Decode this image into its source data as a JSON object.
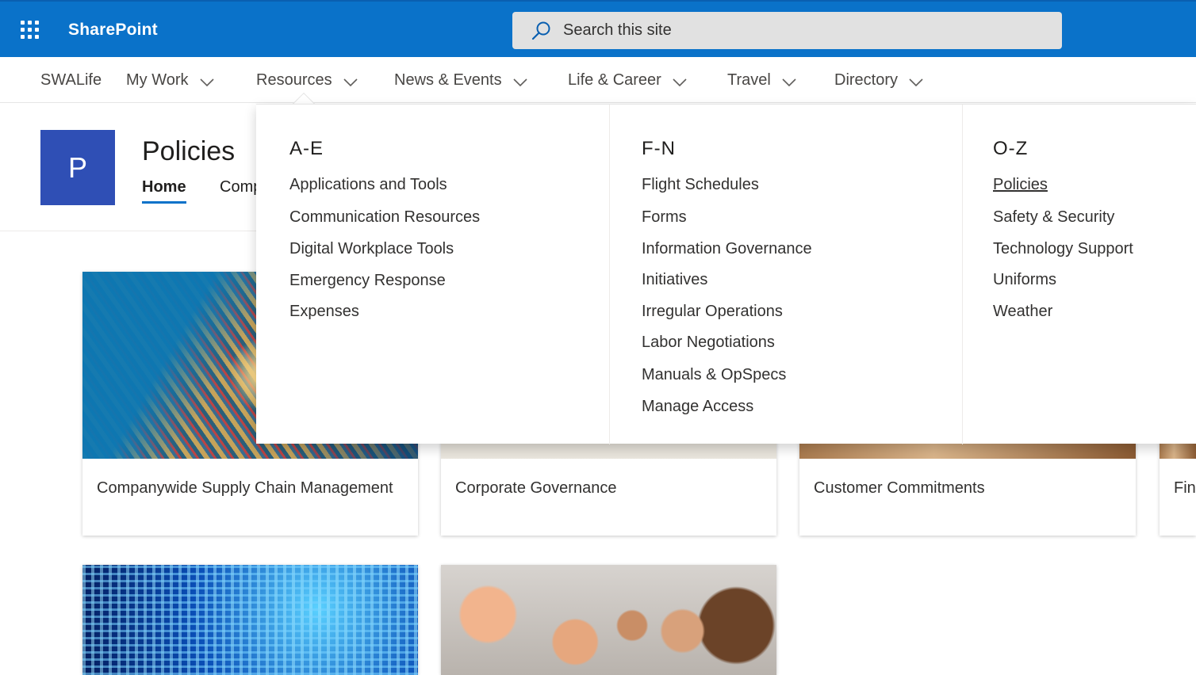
{
  "suite": {
    "brand": "SharePoint",
    "search_placeholder": "Search this site",
    "accent": "#0a72c9"
  },
  "hub_nav": {
    "items": [
      {
        "label": "SWALife",
        "has_dropdown": false
      },
      {
        "label": "My Work",
        "has_dropdown": true
      },
      {
        "label": "Resources",
        "has_dropdown": true
      },
      {
        "label": "News & Events",
        "has_dropdown": true
      },
      {
        "label": "Life & Career",
        "has_dropdown": true
      },
      {
        "label": "Travel",
        "has_dropdown": true
      },
      {
        "label": "Directory",
        "has_dropdown": true
      }
    ]
  },
  "site": {
    "logo_letter": "P",
    "logo_color": "#2f4fb5",
    "title": "Policies",
    "tabs": [
      {
        "label": "Home",
        "active": true
      },
      {
        "label": "Comp",
        "active": false
      }
    ]
  },
  "cards": [
    {
      "label": "Companywide Supply Chain Management"
    },
    {
      "label": "Corporate Governance"
    },
    {
      "label": "Customer Commitments"
    },
    {
      "label": "Fin"
    },
    {
      "label": ""
    },
    {
      "label": ""
    }
  ],
  "mega_menu": {
    "columns": [
      {
        "heading": "A-E",
        "links": [
          "Applications and Tools",
          "Communication Resources",
          "Digital Workplace Tools",
          "Emergency Response",
          "Expenses"
        ]
      },
      {
        "heading": "F-N",
        "links": [
          "Flight Schedules",
          "Forms",
          "Information Governance",
          "Initiatives",
          "Irregular Operations",
          "Labor Negotiations",
          "Manuals & OpSpecs",
          "Manage Access"
        ]
      },
      {
        "heading": "O-Z",
        "links": [
          "Policies",
          "Safety & Security",
          "Technology Support",
          "Uniforms",
          "Weather"
        ],
        "current": "Policies"
      }
    ]
  }
}
